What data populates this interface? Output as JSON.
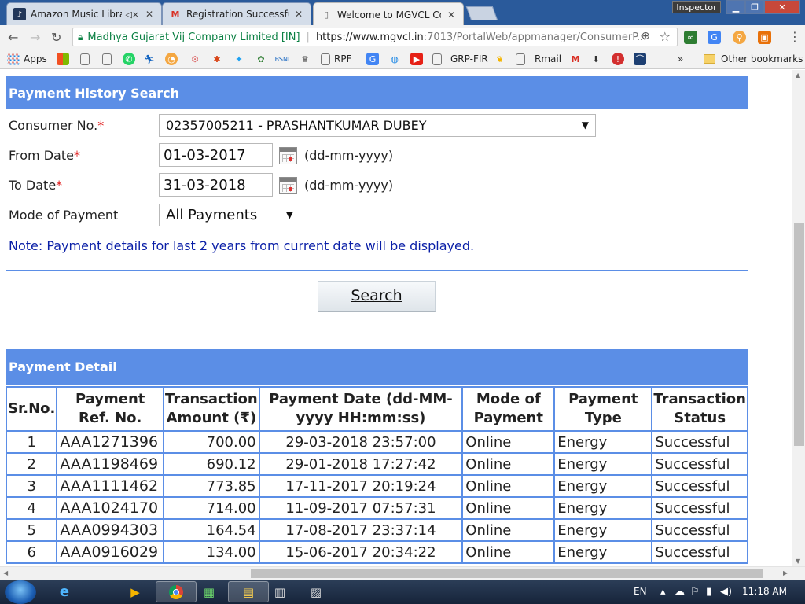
{
  "browser": {
    "tabs": [
      {
        "title": "Amazon Music Library",
        "icon": "amazon-music-icon",
        "muted_icon": "speaker-mute-icon"
      },
      {
        "title": "Registration Successful -",
        "icon": "gmail-icon"
      },
      {
        "title": "Welcome to MGVCL Con",
        "icon": "page-icon"
      }
    ],
    "inspector": "Inspector",
    "address": {
      "secure_label": "Madhya Gujarat Vij Company Limited [IN]",
      "url_host": "https://www.mgvcl.in",
      "url_path": ":7013/PortalWeb/appmanager/ConsumerP..."
    },
    "bookmarks": [
      {
        "label": "Apps",
        "icon": "apps-grid-icon"
      },
      {
        "label": "",
        "icon": "windows-icon"
      },
      {
        "label": "",
        "icon": "page-icon"
      },
      {
        "label": "",
        "icon": "page-icon"
      },
      {
        "label": "",
        "icon": "whatsapp-icon"
      },
      {
        "label": "",
        "icon": "runner-icon"
      },
      {
        "label": "",
        "icon": "pizza-icon"
      },
      {
        "label": "",
        "icon": "gear-red-icon"
      },
      {
        "label": "",
        "icon": "paw-icon"
      },
      {
        "label": "",
        "icon": "twitter-icon"
      },
      {
        "label": "",
        "icon": "flowers-icon"
      },
      {
        "label": "",
        "icon": "bsnl-icon"
      },
      {
        "label": "",
        "icon": "emblem-icon"
      },
      {
        "label": "RPF",
        "icon": "page-icon"
      },
      {
        "label": "",
        "icon": "translate-icon"
      },
      {
        "label": "",
        "icon": "globe-icon"
      },
      {
        "label": "",
        "icon": "youtube-icon"
      },
      {
        "label": "",
        "icon": "page-icon"
      },
      {
        "label": "GRP-FIR",
        "icon": "page-icon"
      },
      {
        "label": "",
        "icon": "chicken-icon"
      },
      {
        "label": "",
        "icon": "page-icon"
      },
      {
        "label": "Rmail",
        "icon": "page-icon"
      },
      {
        "label": "",
        "icon": "gmail-icon"
      },
      {
        "label": "",
        "icon": "download-icon"
      },
      {
        "label": "",
        "icon": "quora-icon"
      },
      {
        "label": "",
        "icon": "amazon-icon"
      }
    ],
    "overflow": "»",
    "other_bookmarks": "Other bookmarks"
  },
  "search_panel": {
    "title": "Payment History Search",
    "consumer": {
      "label": "Consumer No.",
      "required": "*",
      "value": "02357005211 - PRASHANTKUMAR DUBEY"
    },
    "from_date": {
      "label": "From Date",
      "required": "*",
      "value": "01-03-2017",
      "format": "(dd-mm-yyyy)"
    },
    "to_date": {
      "label": "To Date",
      "required": "*",
      "value": "31-03-2018",
      "format": "(dd-mm-yyyy)"
    },
    "mode": {
      "label": "Mode of Payment",
      "value": "All Payments"
    },
    "note": "Note: Payment details for last 2 years from current date will be displayed.",
    "search_button": "Search"
  },
  "payment_detail": {
    "title": "Payment Detail",
    "headers": {
      "sr": "Sr.No.",
      "ref": "Payment Ref. No.",
      "amount": "Transaction Amount (₹)",
      "date": "Payment Date (dd-MM-yyyy HH:mm:ss)",
      "mode": "Mode of Payment",
      "type": "Payment Type",
      "status": "Transaction Status"
    },
    "rows": [
      {
        "sr": "1",
        "ref": "AAA1271396",
        "amount": "700.00",
        "date": "29-03-2018 23:57:00",
        "mode": "Online",
        "type": "Energy",
        "status": "Successful"
      },
      {
        "sr": "2",
        "ref": "AAA1198469",
        "amount": "690.12",
        "date": "29-01-2018 17:27:42",
        "mode": "Online",
        "type": "Energy",
        "status": "Successful"
      },
      {
        "sr": "3",
        "ref": "AAA1111462",
        "amount": "773.85",
        "date": "17-11-2017 20:19:24",
        "mode": "Online",
        "type": "Energy",
        "status": "Successful"
      },
      {
        "sr": "4",
        "ref": "AAA1024170",
        "amount": "714.00",
        "date": "11-09-2017 07:57:31",
        "mode": "Online",
        "type": "Energy",
        "status": "Successful"
      },
      {
        "sr": "5",
        "ref": "AAA0994303",
        "amount": "164.54",
        "date": "17-08-2017 23:37:14",
        "mode": "Online",
        "type": "Energy",
        "status": "Successful"
      },
      {
        "sr": "6",
        "ref": "AAA0916029",
        "amount": "134.00",
        "date": "15-06-2017 20:34:22",
        "mode": "Online",
        "type": "Energy",
        "status": "Successful"
      }
    ]
  },
  "taskbar": {
    "apps": [
      "internet-explorer-icon",
      "media-player-icon",
      "chrome-icon",
      "excel-icon",
      "file-explorer-icon",
      "calculator-icon",
      "notepad-icon"
    ],
    "language": "EN",
    "clock": "11:18 AM"
  },
  "colors": {
    "panel_header": "#5b8ee6",
    "link_blue": "#0a1fa7",
    "required_red": "#e01b1b"
  }
}
